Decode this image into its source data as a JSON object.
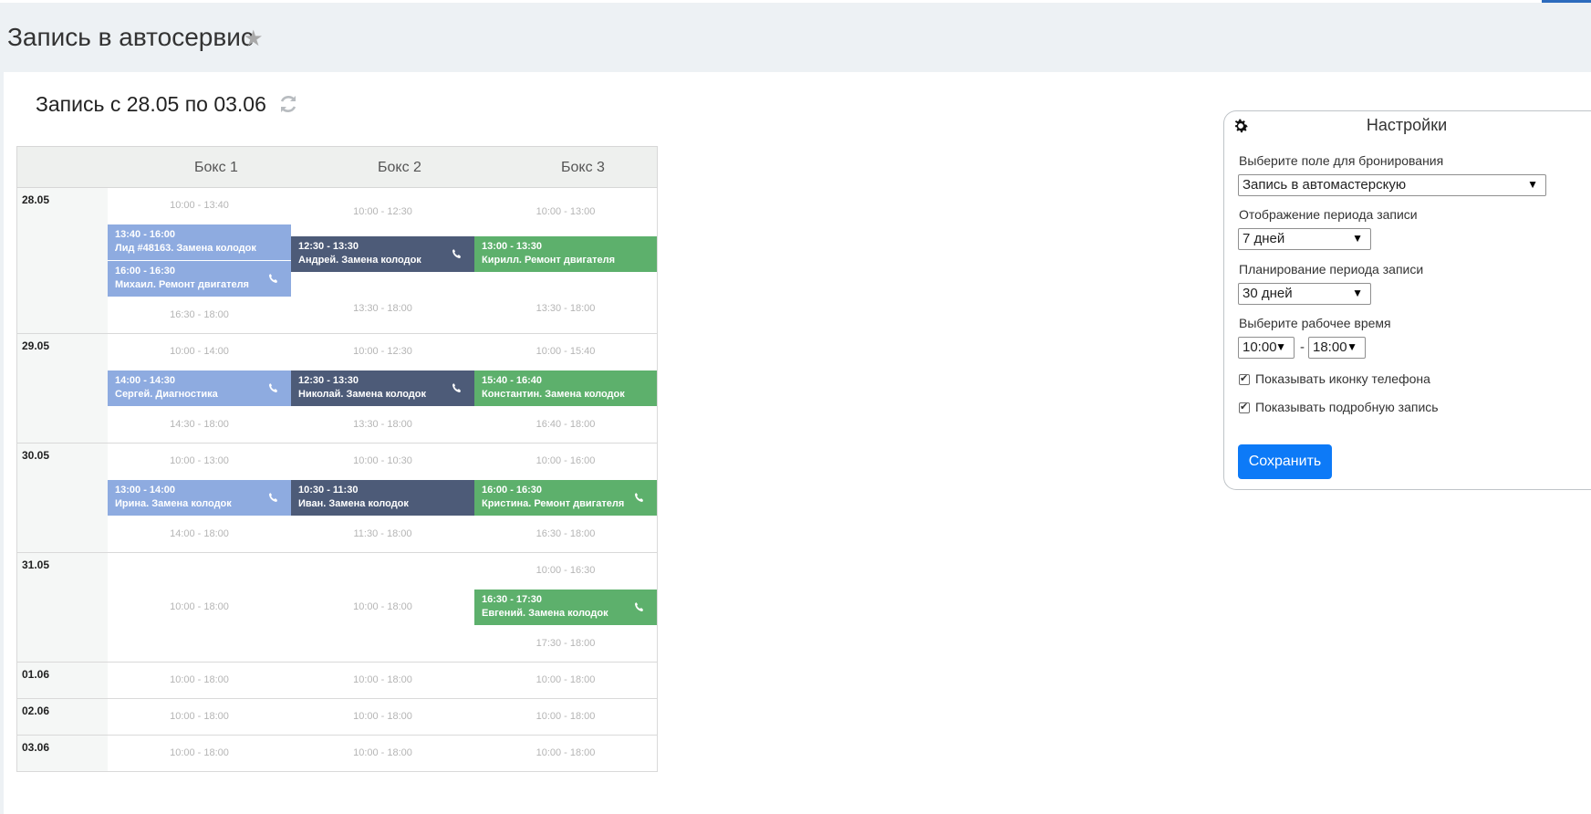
{
  "page": {
    "title": "Запись в автосервис",
    "star_icon": "star-icon"
  },
  "period": {
    "title": "Запись с 28.05 по 03.06",
    "refresh_icon": "refresh-icon"
  },
  "schedule": {
    "columns": [
      "Бокс 1",
      "Бокс 2",
      "Бокс 3"
    ],
    "colors": {
      "box1": "#8eabe0",
      "box2": "#4d5b78",
      "box3": "#5db06c"
    },
    "days": [
      {
        "date": "28.05",
        "cells": [
          [
            {
              "type": "free",
              "text": "10:00 - 13:40"
            },
            {
              "type": "appt",
              "time": "13:40 - 16:00",
              "name": "Лид #48163. Замена колодок",
              "phone": false
            },
            {
              "type": "appt",
              "time": "16:00 - 16:30",
              "name": "Михаил. Ремонт двигателя",
              "phone": true
            },
            {
              "type": "free",
              "text": "16:30 - 18:00"
            }
          ],
          [
            {
              "type": "free",
              "text": "10:00 - 12:30"
            },
            {
              "type": "appt",
              "time": "12:30 - 13:30",
              "name": "Андрей. Замена колодок",
              "phone": true
            },
            {
              "type": "free",
              "text": "13:30 - 18:00"
            }
          ],
          [
            {
              "type": "free",
              "text": "10:00 - 13:00"
            },
            {
              "type": "appt",
              "time": "13:00 - 13:30",
              "name": "Кирилл. Ремонт двигателя",
              "phone": false
            },
            {
              "type": "free",
              "text": "13:30 - 18:00"
            }
          ]
        ]
      },
      {
        "date": "29.05",
        "cells": [
          [
            {
              "type": "free",
              "text": "10:00 - 14:00"
            },
            {
              "type": "appt",
              "time": "14:00 - 14:30",
              "name": "Сергей. Диагностика",
              "phone": true
            },
            {
              "type": "free",
              "text": "14:30 - 18:00"
            }
          ],
          [
            {
              "type": "free",
              "text": "10:00 - 12:30"
            },
            {
              "type": "appt",
              "time": "12:30 - 13:30",
              "name": "Николай. Замена колодок",
              "phone": true
            },
            {
              "type": "free",
              "text": "13:30 - 18:00"
            }
          ],
          [
            {
              "type": "free",
              "text": "10:00 - 15:40"
            },
            {
              "type": "appt",
              "time": "15:40 - 16:40",
              "name": "Константин. Замена колодок",
              "phone": false
            },
            {
              "type": "free",
              "text": "16:40 - 18:00"
            }
          ]
        ]
      },
      {
        "date": "30.05",
        "cells": [
          [
            {
              "type": "free",
              "text": "10:00 - 13:00"
            },
            {
              "type": "appt",
              "time": "13:00 - 14:00",
              "name": "Ирина. Замена колодок",
              "phone": true
            },
            {
              "type": "free",
              "text": "14:00 - 18:00"
            }
          ],
          [
            {
              "type": "free",
              "text": "10:00 - 10:30"
            },
            {
              "type": "appt",
              "time": "10:30 - 11:30",
              "name": "Иван. Замена колодок",
              "phone": false
            },
            {
              "type": "free",
              "text": "11:30 - 18:00"
            }
          ],
          [
            {
              "type": "free",
              "text": "10:00 - 16:00"
            },
            {
              "type": "appt",
              "time": "16:00 - 16:30",
              "name": "Кристина. Ремонт двигателя",
              "phone": true
            },
            {
              "type": "free",
              "text": "16:30 - 18:00"
            }
          ]
        ]
      },
      {
        "date": "31.05",
        "cells": [
          [
            {
              "type": "free",
              "text": "10:00 - 18:00"
            }
          ],
          [
            {
              "type": "free",
              "text": "10:00 - 18:00"
            }
          ],
          [
            {
              "type": "free",
              "text": "10:00 - 16:30"
            },
            {
              "type": "appt",
              "time": "16:30 - 17:30",
              "name": "Евгений. Замена колодок",
              "phone": true
            },
            {
              "type": "free",
              "text": "17:30 - 18:00"
            }
          ]
        ]
      },
      {
        "date": "01.06",
        "cells": [
          [
            {
              "type": "free",
              "text": "10:00 - 18:00"
            }
          ],
          [
            {
              "type": "free",
              "text": "10:00 - 18:00"
            }
          ],
          [
            {
              "type": "free",
              "text": "10:00 - 18:00"
            }
          ]
        ]
      },
      {
        "date": "02.06",
        "cells": [
          [
            {
              "type": "free",
              "text": "10:00 - 18:00"
            }
          ],
          [
            {
              "type": "free",
              "text": "10:00 - 18:00"
            }
          ],
          [
            {
              "type": "free",
              "text": "10:00 - 18:00"
            }
          ]
        ]
      },
      {
        "date": "03.06",
        "cells": [
          [
            {
              "type": "free",
              "text": "10:00 - 18:00"
            }
          ],
          [
            {
              "type": "free",
              "text": "10:00 - 18:00"
            }
          ],
          [
            {
              "type": "free",
              "text": "10:00 - 18:00"
            }
          ]
        ]
      }
    ]
  },
  "settings": {
    "title": "Настройки",
    "gear_icon": "gear-icon",
    "booking_field_label": "Выберите поле для бронирования",
    "booking_field_value": "Запись в автомастерскую",
    "display_period_label": "Отображение периода записи",
    "display_period_value": "7 дней",
    "planning_period_label": "Планирование периода записи",
    "planning_period_value": "30 дней",
    "work_time_label": "Выберите рабочее время",
    "work_time_from": "10:00",
    "work_time_separator": "-",
    "work_time_to": "18:00",
    "show_phone_label": "Показывать иконку телефона",
    "show_phone_checked": true,
    "show_detail_label": "Показывать подробную запись",
    "show_detail_checked": true,
    "save_label": "Сохранить",
    "accent_color": "#0d7af7"
  }
}
